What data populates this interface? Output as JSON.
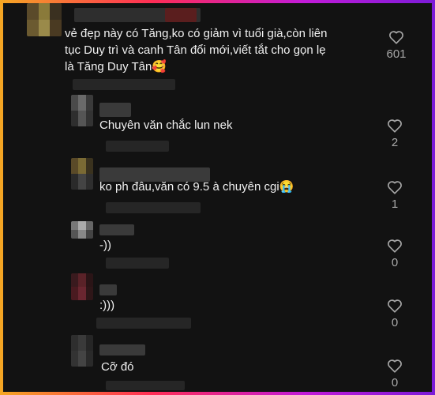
{
  "comments": [
    {
      "text": "vẻ đẹp này có Tăng,ko có giảm vì tuổi già,còn liên tục Duy trì và canh Tân đổi mới,viết tắt cho gọn lẹ là Tăng Duy Tân🥰",
      "likes": "601"
    },
    {
      "text": "Chuyên văn chắc lun nek",
      "likes": "2"
    },
    {
      "text": "ko ph đâu,văn có 9.5 à chuyên cgi😭",
      "likes": "1"
    },
    {
      "text": "-))",
      "likes": "0"
    },
    {
      "text": ":)))",
      "likes": "0"
    },
    {
      "text": "Cỡ đó",
      "likes": "0"
    }
  ]
}
